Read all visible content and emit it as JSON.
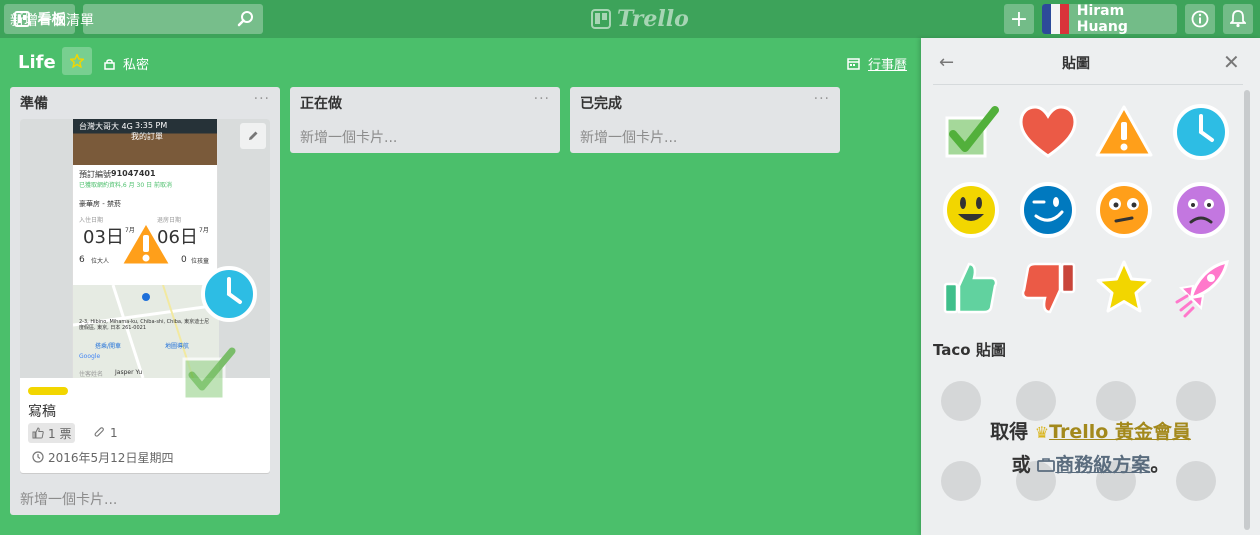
{
  "header": {
    "boards_label": "看板",
    "search_placeholder": "",
    "logo_text": "Trello",
    "user_name": "Hiram Huang"
  },
  "board": {
    "title": "Life",
    "privacy_label": "私密",
    "calendar_label": "行事曆"
  },
  "lists": [
    {
      "title": "準備",
      "add_card_label": "新增一個卡片...",
      "cards": [
        {
          "title": "寫稿",
          "label_color": "#f2d600",
          "vote_text": "1 票",
          "attachments_text": "1",
          "due_text": "2016年5月12日星期四",
          "stickers": [
            "warning",
            "clock",
            "check"
          ]
        }
      ]
    },
    {
      "title": "正在做",
      "add_card_label": "新增一個卡片..."
    },
    {
      "title": "已完成",
      "add_card_label": "新增一個卡片..."
    }
  ],
  "add_list_label": "新增一個清單",
  "phone_screenshot": {
    "status_left": "台灣大哥大 4G",
    "status_time": "3:35 PM",
    "header": "我的訂單",
    "booking_label": "預訂編號",
    "booking_number": "91047401",
    "booking_note": "已獲取網約資料,6 月 30 日 前取消",
    "room": "豪華房 - 禁菸",
    "checkin_label": "入住日期",
    "checkin_day": "03日",
    "checkout_label": "退房日期",
    "checkout_day": "06日",
    "month_note": "7月",
    "adults": "6",
    "adults_label": "位大人",
    "children": "0",
    "children_label": "位孩童",
    "address": "2-3, Hibino, Mihama-ku, Chiba-shi, Chiba, 東京迪士尼度假區, 東京, 日本 261-0021",
    "directions_label": "搭乘/開車",
    "map_label": "地圖導航",
    "map_provider": "Google",
    "guest_label": "住客姓名",
    "guest_name": "Jasper Yu"
  },
  "sticker_panel": {
    "title": "貼圖",
    "stickers": [
      "check",
      "heart",
      "warning",
      "clock",
      "smile",
      "laugh",
      "huh",
      "frown",
      "thumbsup",
      "thumbsdown",
      "star",
      "rocketship"
    ],
    "taco_title": "Taco 貼圖",
    "upsell_prefix": "取得",
    "gold_label": "Trello 黃金會員",
    "upsell_or": "或",
    "business_label": "商務級方案",
    "upsell_suffix": "。"
  },
  "colors": {
    "board_bg": "#4bbf6b",
    "header_bg": "#3da35a",
    "list_bg": "#e2e4e6",
    "gold": "#a3891c"
  }
}
